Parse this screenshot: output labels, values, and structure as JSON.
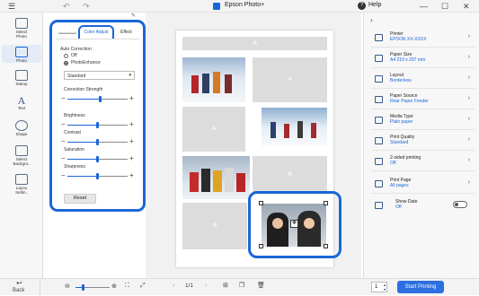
{
  "titlebar": {
    "title": "Epson Photo+",
    "help": "Help"
  },
  "left_nav": {
    "items": [
      {
        "label_1": "Select",
        "label_2": "Photo"
      },
      {
        "label_1": "Photo",
        "label_2": ""
      },
      {
        "label_1": "Stamp",
        "label_2": ""
      },
      {
        "label_1": "Text",
        "label_2": ""
      },
      {
        "label_1": "Shape",
        "label_2": ""
      },
      {
        "label_1": "Select",
        "label_2": "Backgro.."
      },
      {
        "label_1": "Layou",
        "label_2": "Settin.."
      }
    ]
  },
  "panel": {
    "tabs": {
      "first": "Color Adjust",
      "second": "Effect"
    },
    "auto_correction": "Auto Correction",
    "radio_off": "Off",
    "radio_photoenhance": "PhotoEnhance",
    "dropdown_value": "Standard",
    "correction_strength": {
      "label": "Correction Strength",
      "level": 0.55
    },
    "brightness": {
      "label": "Brightness",
      "level": 0.5
    },
    "contrast": {
      "label": "Contrast",
      "level": 0.5
    },
    "saturation": {
      "label": "Saturation",
      "level": 0.5
    },
    "sharpness": {
      "label": "Sharpness",
      "level": 0.5
    },
    "reset_label": "Reset"
  },
  "canvas": {
    "placeholder_letter": "A",
    "selected_photo_color": "#1a66d6"
  },
  "right_panel": {
    "items": [
      {
        "key": "Printer",
        "value": "EPSON XX-XXXX"
      },
      {
        "key": "Paper Size",
        "value": "A4 210 x 297 mm"
      },
      {
        "key": "Layout",
        "value": "Borderless"
      },
      {
        "key": "Paper Source",
        "value": "Rear Paper Feeder"
      },
      {
        "key": "Media Type",
        "value": "Plain paper"
      },
      {
        "key": "Print Quality",
        "value": "Standard"
      },
      {
        "key": "2-sided printing",
        "value": "Off"
      },
      {
        "key": "Print Page",
        "value": "All pages"
      },
      {
        "key": "Show Date",
        "value": "Off"
      }
    ]
  },
  "bottom": {
    "back_label": "Back",
    "page_indicator": "1/1",
    "copies": "1",
    "print_label": "Start Printing"
  },
  "colors": {
    "accent": "#1a66d6",
    "print_button": "#2b6fe0"
  }
}
